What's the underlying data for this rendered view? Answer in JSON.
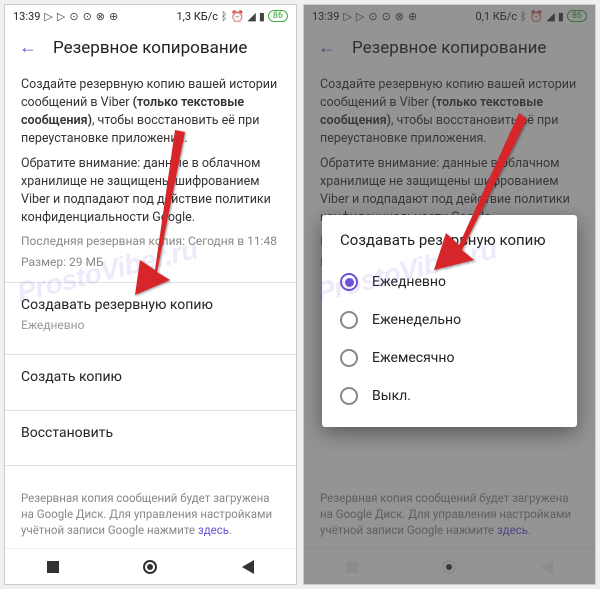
{
  "statusbar": {
    "time": "13:39",
    "speed_left": "1,3 КБ/с",
    "speed_right": "0,1 КБ/с",
    "battery": "86"
  },
  "header": {
    "title": "Резервное копирование"
  },
  "desc": {
    "line1a": "Создайте резервную копию вашей истории сообщений в Viber ",
    "line1b": "(только текстовые сообщения)",
    "line1c": ", чтобы восстановить её при переустановке приложения.",
    "line2": "Обратите внимание: данные в облачном хранилище не защищены шифрованием Viber и подпадают под действие политики конфиденциальности Google."
  },
  "meta": {
    "last": "Последняя резервная копия: Сегодня в 11:48",
    "size": "Размер: 29 МБ"
  },
  "rows": {
    "create_schedule": {
      "title": "Создавать резервную копию",
      "sub": "Ежедневно"
    },
    "create_now": {
      "title": "Создать копию"
    },
    "restore": {
      "title": "Восстановить"
    }
  },
  "footer": {
    "text": "Резервная копия сообщений будет загружена на Google Диск. Для управления настройками учётной записи Google нажмите ",
    "link": "здесь"
  },
  "dialog": {
    "title": "Создавать резервную копию",
    "options": [
      "Ежедневно",
      "Еженедельно",
      "Ежемесячно",
      "Выкл."
    ],
    "selected_index": 0
  },
  "watermark": "ProstoViber.ru"
}
